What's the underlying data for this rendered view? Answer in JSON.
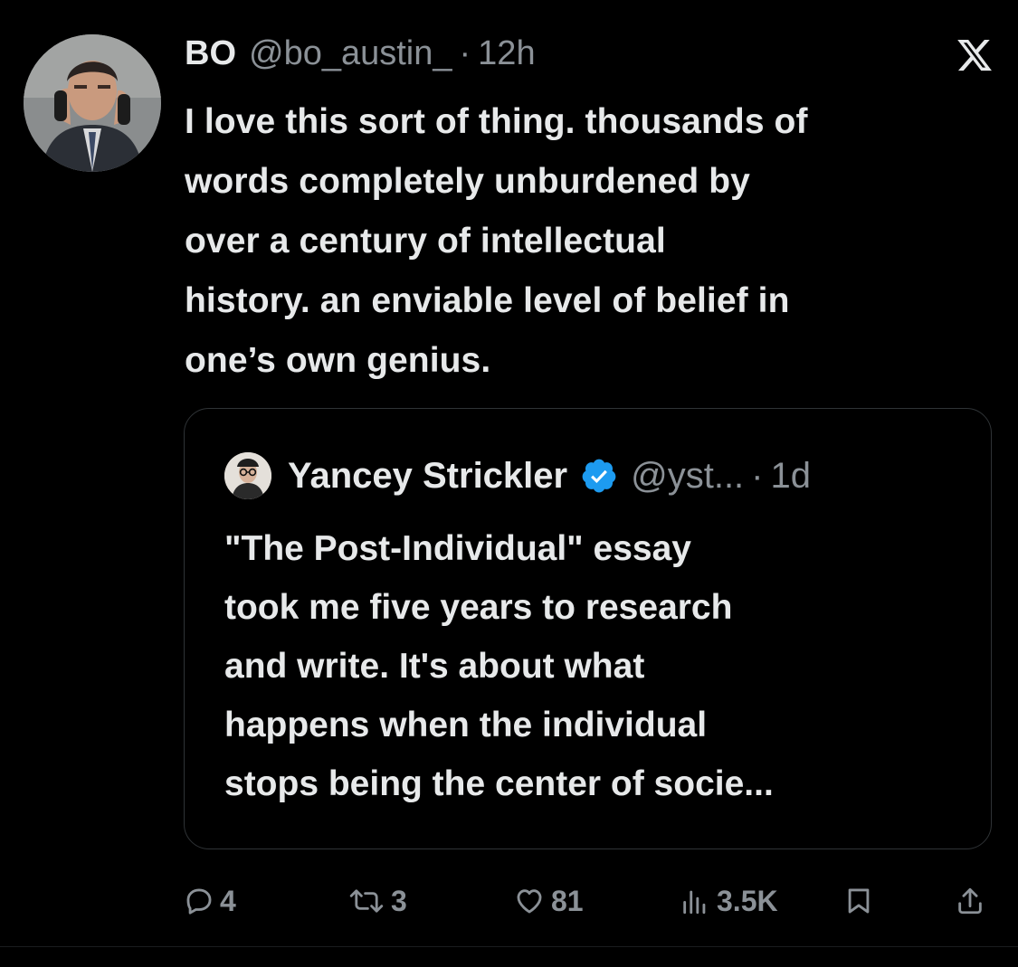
{
  "post": {
    "author_name": "BO",
    "author_handle": "@bo_austin_",
    "separator": "·",
    "timestamp": "12h",
    "platform_icon": "x-logo-icon",
    "text_lines": [
      "I love this sort of thing. thousands of",
      "words completely unburdened by",
      "over a century of intellectual",
      "history. an enviable level of belief in",
      "one’s own genius."
    ]
  },
  "quoted_post": {
    "author_name": "Yancey Strickler",
    "verified_icon": "verified-badge-icon",
    "author_handle": "@yst...",
    "separator": "·",
    "timestamp": "1d",
    "text_lines": [
      "\"The Post-Individual\" essay",
      "took me five years to research",
      "and write. It's about what",
      "happens when the individual",
      "stops being the center of socie..."
    ]
  },
  "actions": {
    "replies": "4",
    "reposts": "3",
    "likes": "81",
    "views": "3.5K",
    "bookmark_icon": "bookmark-icon",
    "share_icon": "share-icon"
  },
  "colors": {
    "background": "#000000",
    "text_primary": "#e7e9ea",
    "text_secondary": "#8b9197",
    "border": "#2f3336",
    "verified_blue": "#1d9bf0"
  }
}
